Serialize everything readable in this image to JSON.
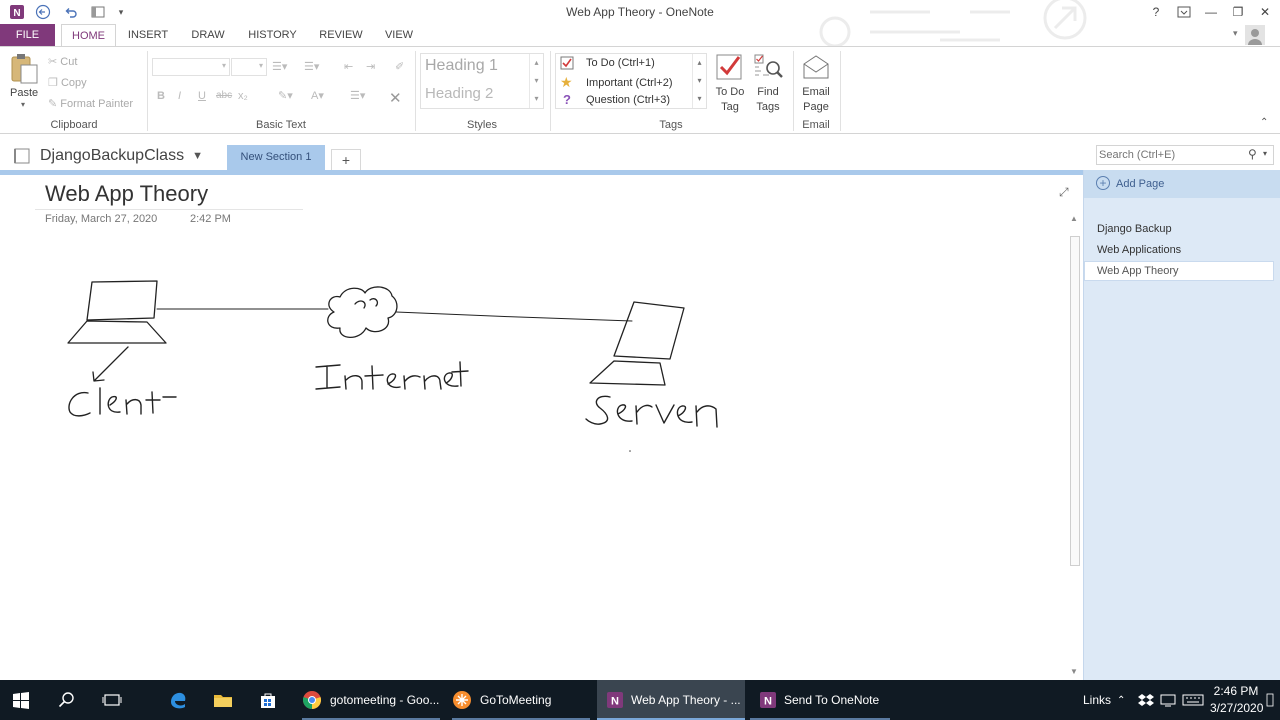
{
  "window": {
    "title": "Web App Theory - OneNote",
    "help_glyph": "?",
    "minimize_glyph": "—",
    "restore_glyph": "❐",
    "close_glyph": "✕"
  },
  "ribbon_tabs": [
    {
      "label": "FILE"
    },
    {
      "label": "HOME"
    },
    {
      "label": "INSERT"
    },
    {
      "label": "DRAW"
    },
    {
      "label": "HISTORY"
    },
    {
      "label": "REVIEW"
    },
    {
      "label": "VIEW"
    }
  ],
  "clipboard": {
    "paste": "Paste",
    "cut": "Cut",
    "copy": "Copy",
    "format_painter": "Format Painter",
    "group_label": "Clipboard"
  },
  "basic_text": {
    "group_label": "Basic Text",
    "bold": "B",
    "italic": "I",
    "underline": "U",
    "strike": "abc",
    "subscript": "x₂"
  },
  "styles": {
    "heading1": "Heading 1",
    "heading2": "Heading 2",
    "group_label": "Styles"
  },
  "tags": {
    "items": [
      {
        "label": "To Do (Ctrl+1)",
        "icon": "checkbox-icon"
      },
      {
        "label": "Important (Ctrl+2)",
        "icon": "star-icon"
      },
      {
        "label": "Question (Ctrl+3)",
        "icon": "question-icon"
      }
    ],
    "todo_tag_line1": "To Do",
    "todo_tag_line2": "Tag",
    "find_tags_line1": "Find",
    "find_tags_line2": "Tags",
    "group_label": "Tags"
  },
  "email": {
    "line1": "Email",
    "line2": "Page",
    "group_label": "Email"
  },
  "notebook": {
    "name": "DjangoBackupClass",
    "section_tab": "New Section 1",
    "add_section": "+"
  },
  "search": {
    "placeholder": "Search (Ctrl+E)"
  },
  "page": {
    "title": "Web App Theory",
    "date": "Friday, March 27, 2020",
    "time": "2:42 PM",
    "ink_labels": {
      "client": "Client",
      "internet": "Internet",
      "server": "Server"
    }
  },
  "pages_pane": {
    "add_page": "Add Page",
    "pages": [
      {
        "label": "Django Backup"
      },
      {
        "label": "Web Applications"
      },
      {
        "label": "Web App Theory",
        "selected": true
      }
    ]
  },
  "taskbar": {
    "items": [
      {
        "label": "gotomeeting - Goo...",
        "icon": "chrome-icon"
      },
      {
        "label": "GoToMeeting",
        "icon": "gotomeeting-icon"
      },
      {
        "label": "Web App Theory - ...",
        "icon": "onenote-icon",
        "active": true
      },
      {
        "label": "Send To OneNote",
        "icon": "onenote-send-icon"
      }
    ],
    "links": "Links",
    "time": "2:46 PM",
    "date": "3/27/2020"
  },
  "colors": {
    "onenote_purple": "#80397b",
    "section_blue": "#a9c9eb",
    "pane_bg": "#dde9f6",
    "taskbar": "#101a23"
  }
}
